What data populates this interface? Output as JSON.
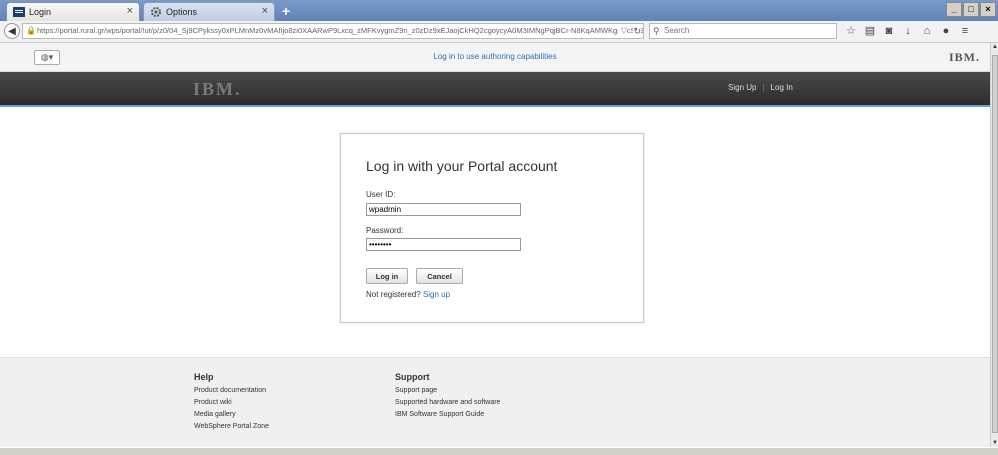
{
  "browser": {
    "tabs": [
      {
        "label": "Login",
        "close": "×"
      },
      {
        "label": "Options",
        "close": "×"
      }
    ],
    "new_tab": "+",
    "window_buttons": [
      "_",
      "□",
      "×"
    ],
    "url": "https://portal.rural.gr/wps/portal/!ut/p/z0/04_Sj9CPykssy0xPLMnMz0vMAfIjo8zi0XAARwP9Lxcq_zMFKvygmZ9n_z0zDz9xEJaojCkHQ2cgoycyA0M3IMNgPqjBCr-N8KqAMWKgpwcS8908RUUASklz",
    "search_placeholder": "Search",
    "toolbar_icons": [
      "star-icon",
      "reading-list-icon",
      "pocket-icon",
      "download-icon",
      "home-icon",
      "chat-icon",
      "menu-icon"
    ]
  },
  "portal_top": {
    "authoring_link": "Log in to use authoring capabilities",
    "brand": "IBM."
  },
  "header": {
    "logo": "IBM.",
    "links": [
      "Sign Up",
      "Log In"
    ]
  },
  "login": {
    "title": "Log in with your Portal account",
    "userid_label": "User ID:",
    "userid_value": "wpadmin",
    "password_label": "Password:",
    "password_value": "••••••••",
    "login_button": "Log in",
    "cancel_button": "Cancel",
    "not_registered": "Not registered?",
    "signup_link": "Sign up"
  },
  "footer": {
    "help": {
      "title": "Help",
      "links": [
        "Product documentation",
        "Product wiki",
        "Media gallery",
        "WebSphere Portal Zone"
      ]
    },
    "support": {
      "title": "Support",
      "links": [
        "Support page",
        "Supported hardware and software",
        "IBM Software Support Guide"
      ]
    }
  }
}
